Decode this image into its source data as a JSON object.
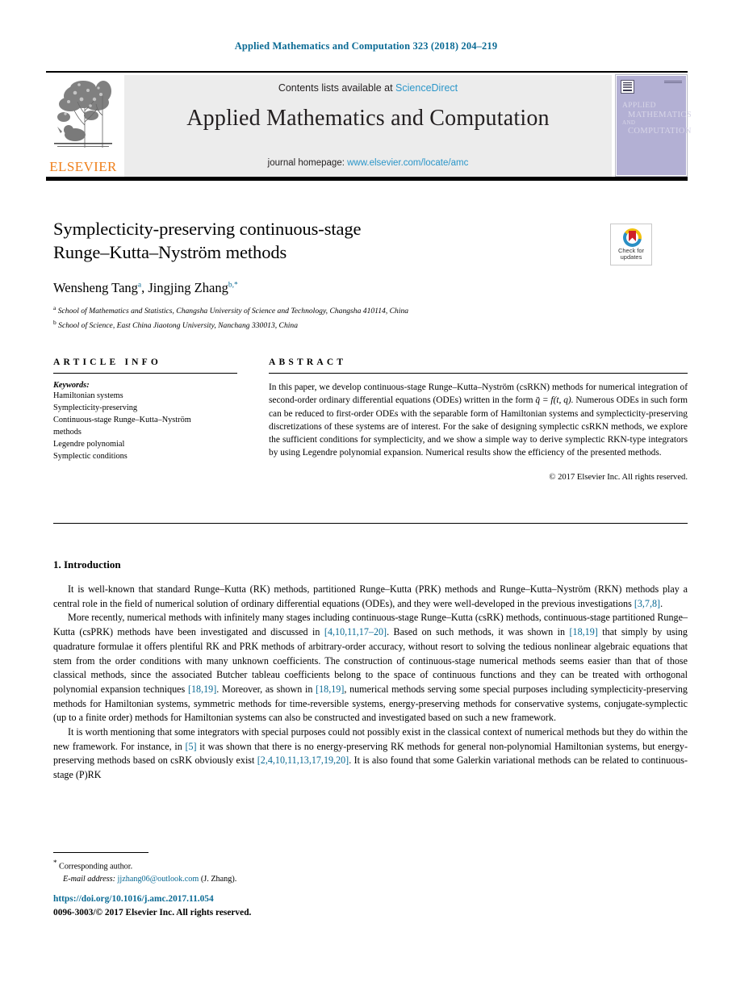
{
  "running_head": "Applied Mathematics and Computation 323 (2018) 204–219",
  "banner": {
    "contents_prefix": "Contents lists available at ",
    "contents_link": "ScienceDirect",
    "journal_title": "Applied Mathematics and Computation",
    "homepage_prefix": "journal homepage: ",
    "homepage_link": "www.elsevier.com/locate/amc",
    "publisher_wordmark": "ELSEVIER",
    "cover": {
      "line1": "APPLIED",
      "line2": "MATHEMATICS",
      "line3": "AND",
      "line4": "COMPUTATION"
    }
  },
  "crossmark": {
    "label_line1": "Check for",
    "label_line2": "updates"
  },
  "article": {
    "title_line1": "Symplecticity-preserving continuous-stage",
    "title_line2": "Runge–Kutta–Nyström methods",
    "author1_name": "Wensheng Tang",
    "author1_marker": "a",
    "author2_name": "Jingjing Zhang",
    "author2_marker": "b,",
    "author2_star": "*",
    "affiliation_a_marker": "a",
    "affiliation_a": "School of Mathematics and Statistics, Changsha University of Science and Technology, Changsha 410114, China",
    "affiliation_b_marker": "b",
    "affiliation_b": "School of Science, East China Jiaotong University, Nanchang 330013, China"
  },
  "info": {
    "heading": "ARTICLE INFO",
    "keywords_label": "Keywords:",
    "keywords": [
      "Hamiltonian systems",
      "Symplecticity-preserving",
      "Continuous-stage Runge–Kutta–Nyström",
      "methods",
      "Legendre polynomial",
      "Symplectic conditions"
    ]
  },
  "abstract": {
    "heading": "ABSTRACT",
    "text_part1": "In this paper, we develop continuous-stage Runge–Kutta–Nyström (csRKN) methods for numerical integration of second-order ordinary differential equations (ODEs) written in the form ",
    "formula": "q̈ = f(t, q).",
    "text_part2": " Numerous ODEs in such form can be reduced to first-order ODEs with the separable form of Hamiltonian systems and symplecticity-preserving discretizations of these systems are of interest. For the sake of designing symplectic csRKN methods, we explore the sufficient conditions for symplecticity, and we show a simple way to derive symplectic RKN-type integrators by using Legendre polynomial expansion. Numerical results show the efficiency of the presented methods.",
    "copyright": "© 2017 Elsevier Inc. All rights reserved."
  },
  "section": {
    "heading": "1. Introduction",
    "paragraphs": [
      {
        "segments": [
          {
            "t": "It is well-known that standard Runge–Kutta (RK) methods, partitioned Runge–Kutta (PRK) methods and Runge–Kutta–Nyström (RKN) methods play a central role in the field of numerical solution of ordinary differential equations (ODEs), and they were well-developed in the previous investigations ",
            "cite": false
          },
          {
            "t": "[3,7,8]",
            "cite": true
          },
          {
            "t": ".",
            "cite": false
          }
        ]
      },
      {
        "segments": [
          {
            "t": "More recently, numerical methods with infinitely many stages including continuous-stage Runge–Kutta (csRK) methods, continuous-stage partitioned Runge–Kutta (csPRK) methods have been investigated and discussed in ",
            "cite": false
          },
          {
            "t": "[4,10,11,17–20]",
            "cite": true
          },
          {
            "t": ". Based on such methods, it was shown in ",
            "cite": false
          },
          {
            "t": "[18,19]",
            "cite": true
          },
          {
            "t": " that simply by using quadrature formulae it offers plentiful RK and PRK methods of arbitrary-order accuracy, without resort to solving the tedious nonlinear algebraic equations that stem from the order conditions with many unknown coefficients. The construction of continuous-stage numerical methods seems easier than that of those classical methods, since the associated Butcher tableau coefficients belong to the space of continuous functions and they can be treated with orthogonal polynomial expansion techniques ",
            "cite": false
          },
          {
            "t": "[18,19]",
            "cite": true
          },
          {
            "t": ". Moreover, as shown in ",
            "cite": false
          },
          {
            "t": "[18,19]",
            "cite": true
          },
          {
            "t": ", numerical methods serving some special purposes including symplecticity-preserving methods for Hamiltonian systems, symmetric methods for time-reversible systems, energy-preserving methods for conservative systems, conjugate-symplectic (up to a finite order) methods for Hamiltonian systems can also be constructed and investigated based on such a new framework.",
            "cite": false
          }
        ]
      },
      {
        "segments": [
          {
            "t": "It is worth mentioning that some integrators with special purposes could not possibly exist in the classical context of numerical methods but they do within the new framework. For instance, in ",
            "cite": false
          },
          {
            "t": "[5]",
            "cite": true
          },
          {
            "t": " it was shown that there is no energy-preserving RK methods for general non-polynomial Hamiltonian systems, but energy-preserving methods based on csRK obviously exist ",
            "cite": false
          },
          {
            "t": "[2,4,10,11,13,17,19,20]",
            "cite": true
          },
          {
            "t": ". It is also found that some Galerkin variational methods can be related to continuous-stage (P)RK",
            "cite": false
          }
        ]
      }
    ]
  },
  "footer": {
    "corresponding_marker": "*",
    "corresponding_text": "Corresponding author.",
    "email_label": "E-mail address:",
    "email": "jjzhang06@outlook.com",
    "email_suffix": "(J. Zhang).",
    "doi": "https://doi.org/10.1016/j.amc.2017.11.054",
    "issn_line": "0096-3003/© 2017 Elsevier Inc. All rights reserved."
  },
  "colors": {
    "link_blue": "#0a6a94",
    "science_direct_blue": "#2b96c9",
    "elsevier_orange": "#ef7f1a",
    "banner_gray": "#ececec",
    "cover_purple": "#b3b0d4"
  }
}
